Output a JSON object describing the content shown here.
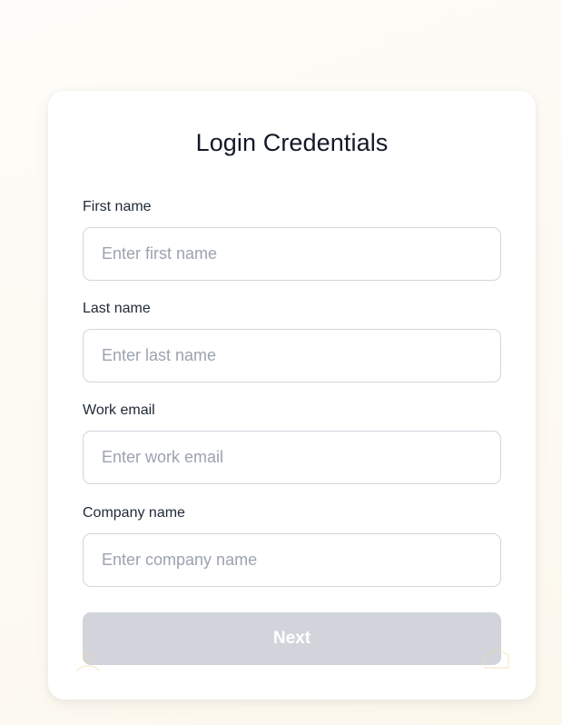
{
  "form": {
    "title": "Login Credentials",
    "fields": [
      {
        "label": "First name",
        "placeholder": "Enter first name",
        "value": ""
      },
      {
        "label": "Last name",
        "placeholder": "Enter last name",
        "value": ""
      },
      {
        "label": "Work email",
        "placeholder": "Enter work email",
        "value": ""
      },
      {
        "label": "Company name",
        "placeholder": "Enter company name",
        "value": ""
      }
    ],
    "next_label": "Next",
    "next_enabled": false
  },
  "icons": {
    "decorative_left": "user-icon",
    "decorative_right": "building-icon"
  },
  "colors": {
    "page_background": "#fdfaf2",
    "card_background": "#ffffff",
    "title_text": "#111827",
    "input_border": "#d1d5db",
    "placeholder_text": "#9ca3af",
    "button_disabled_bg": "#d1d5db",
    "button_text": "#ffffff",
    "decorative_icon": "#f3d9a6"
  }
}
